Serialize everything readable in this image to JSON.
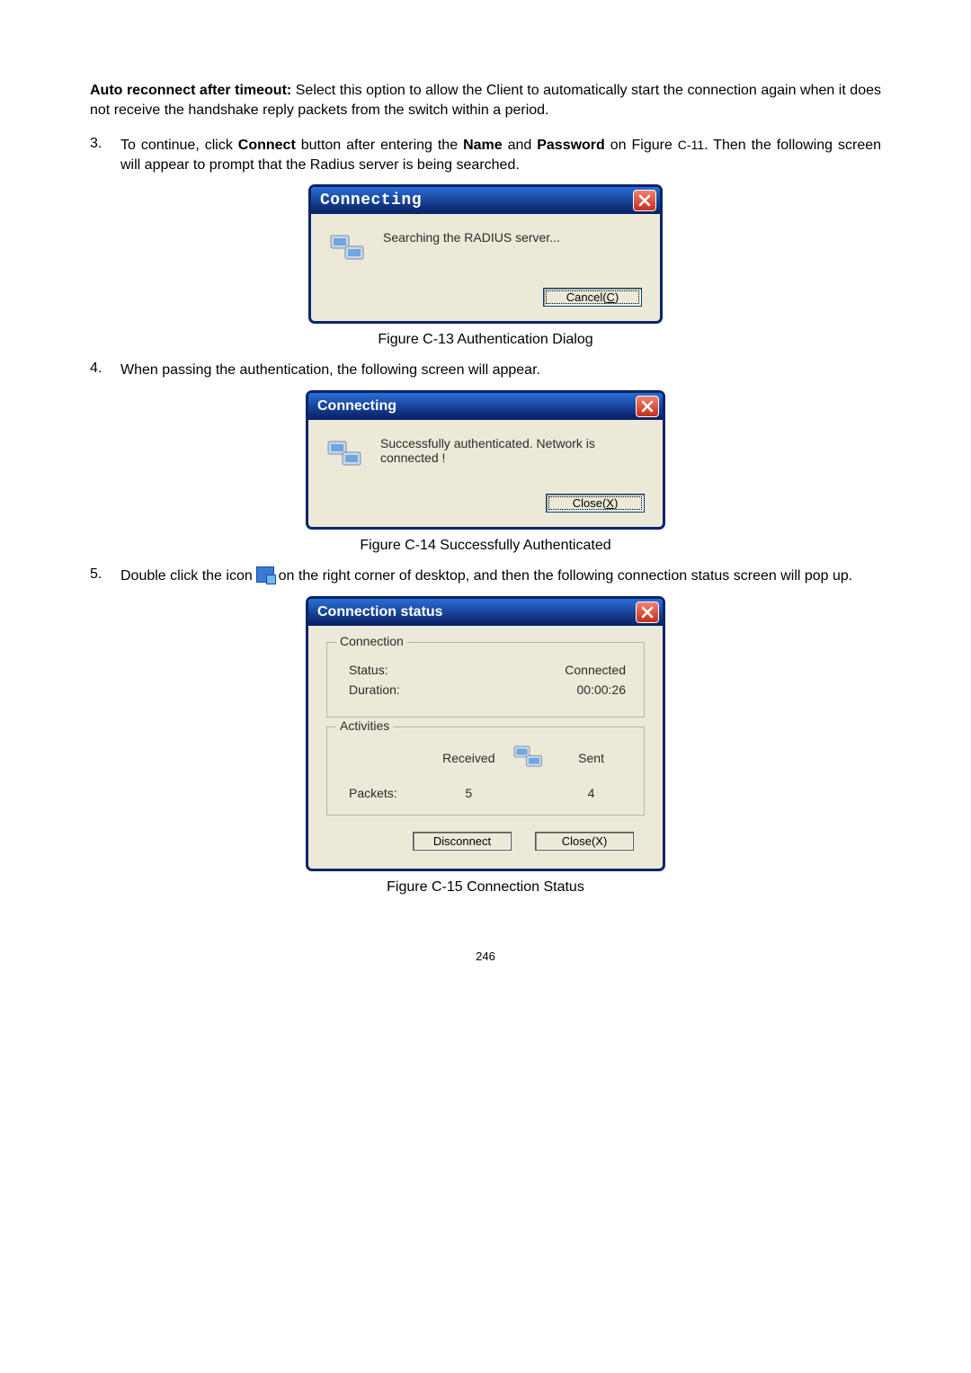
{
  "intro": {
    "bold_lead": "Auto reconnect after timeout:",
    "rest": " Select this option to allow the Client to automatically start the connection again when it does not receive the handshake reply packets from the switch within a period."
  },
  "item3": {
    "num": "3.",
    "pre": "To continue, click ",
    "b1": "Connect",
    "mid1": " button after entering the ",
    "b2": "Name",
    "mid2": " and ",
    "b3": "Password",
    "post1": " on Figure ",
    "figref": "C-11",
    "post2": ". Then the following screen will appear to prompt that the Radius server is being searched."
  },
  "dialog1": {
    "title": "Connecting",
    "message": "Searching the RADIUS server...",
    "cancel_pre": "Cancel(",
    "cancel_uchar": "C",
    "cancel_post": ")"
  },
  "caption1": "Figure C-13 Authentication Dialog",
  "item4": {
    "num": "4.",
    "text": "When passing the authentication, the following screen will appear."
  },
  "dialog2": {
    "title": "Connecting",
    "message": "Successfully authenticated. Network is connected !",
    "close_pre": "Close(",
    "close_uchar": "X",
    "close_post": ")"
  },
  "caption2": "Figure C-14 Successfully Authenticated",
  "item5": {
    "num": "5.",
    "pre": "Double click the icon ",
    "post": " on the right corner of desktop, and then the following connection status screen will pop up."
  },
  "dialog3": {
    "title": "Connection status",
    "group1_title": "Connection",
    "status_label": "Status:",
    "status_value": "Connected",
    "duration_label": "Duration:",
    "duration_value": "00:00:26",
    "group2_title": "Activities",
    "received_label": "Received",
    "sent_label": "Sent",
    "packets_label": "Packets:",
    "received_value": "5",
    "sent_value": "4",
    "disconnect_label": "Disconnect",
    "close_pre": "Close(",
    "close_uchar": "X",
    "close_post": ")"
  },
  "caption3": "Figure C-15 Connection Status",
  "page_number": "246"
}
